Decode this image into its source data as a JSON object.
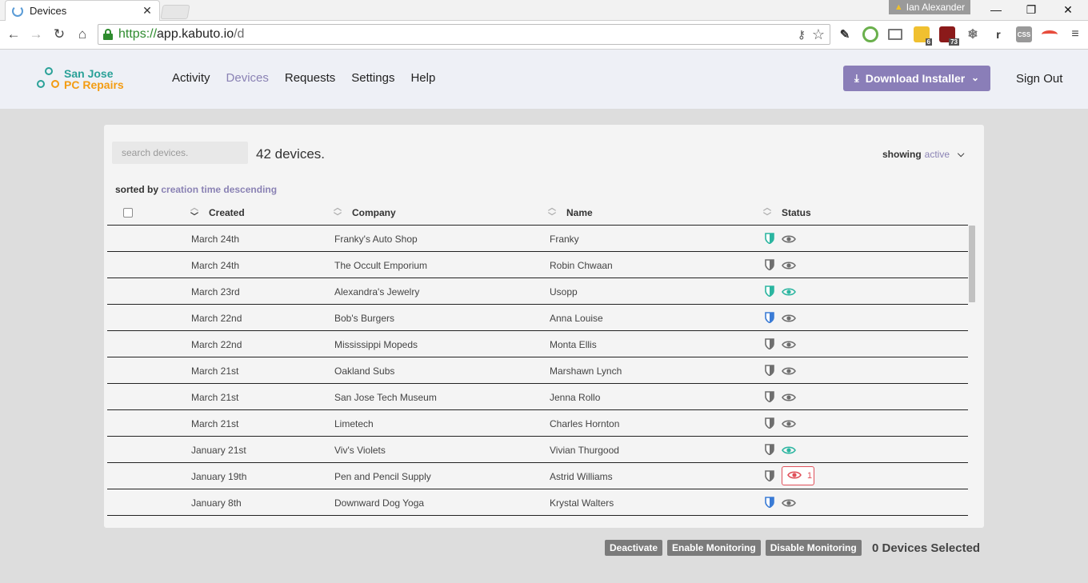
{
  "browser": {
    "tab_title": "Devices",
    "profile_name": "Ian Alexander",
    "url_proto": "https://",
    "url_host": "app.kabuto.io",
    "url_path": "/d",
    "ext_badges": [
      "6",
      "73"
    ]
  },
  "brand": {
    "line1": "San Jose",
    "line2": "PC Repairs"
  },
  "nav": {
    "items": [
      {
        "label": "Activity"
      },
      {
        "label": "Devices"
      },
      {
        "label": "Requests"
      },
      {
        "label": "Settings"
      },
      {
        "label": "Help"
      }
    ],
    "active": "Devices"
  },
  "header": {
    "download_label": "Download Installer",
    "signout_label": "Sign Out"
  },
  "toolbar": {
    "search_placeholder": "search devices.",
    "device_count": "42 devices.",
    "showing_label": "showing",
    "showing_value": "active",
    "sorted_label": "sorted by",
    "sorted_value": "creation time descending"
  },
  "table": {
    "columns": [
      "Created",
      "Company",
      "Name",
      "Status"
    ],
    "rows": [
      {
        "created": "March 24th",
        "company": "Franky's Auto Shop",
        "name": "Franky",
        "shield": "green",
        "eye": "gray"
      },
      {
        "created": "March 24th",
        "company": "The Occult Emporium",
        "name": "Robin Chwaan",
        "shield": "gray",
        "eye": "gray"
      },
      {
        "created": "March 23rd",
        "company": "Alexandra's Jewelry",
        "name": "Usopp",
        "shield": "green",
        "eye": "green"
      },
      {
        "created": "March 22nd",
        "company": "Bob's Burgers",
        "name": "Anna Louise",
        "shield": "blue",
        "eye": "gray"
      },
      {
        "created": "March 22nd",
        "company": "Mississippi Mopeds",
        "name": "Monta Ellis",
        "shield": "gray",
        "eye": "gray"
      },
      {
        "created": "March 21st",
        "company": "Oakland Subs",
        "name": "Marshawn Lynch",
        "shield": "gray",
        "eye": "gray"
      },
      {
        "created": "March 21st",
        "company": "San Jose Tech Museum",
        "name": "Jenna Rollo",
        "shield": "gray",
        "eye": "gray"
      },
      {
        "created": "March 21st",
        "company": "Limetech",
        "name": "Charles Hornton",
        "shield": "gray",
        "eye": "gray"
      },
      {
        "created": "January 21st",
        "company": "Viv's Violets",
        "name": "Vivian Thurgood",
        "shield": "gray",
        "eye": "green"
      },
      {
        "created": "January 19th",
        "company": "Pen and Pencil Supply",
        "name": "Astrid Williams",
        "shield": "gray",
        "eye": "alert",
        "alert_count": "1"
      },
      {
        "created": "January 8th",
        "company": "Downward Dog Yoga",
        "name": "Krystal Walters",
        "shield": "blue",
        "eye": "gray"
      }
    ]
  },
  "footer": {
    "deactivate_label": "Deactivate",
    "enable_label": "Enable Monitoring",
    "disable_label": "Disable Monitoring",
    "selected_text": "0 Devices Selected"
  },
  "colors": {
    "accent": "#8a7eb8",
    "shield_green": "#2bb5a0",
    "shield_blue": "#3a7bd5",
    "shield_gray": "#6e6e6e",
    "eye_gray": "#6e6e6e",
    "eye_green": "#2bb5a0",
    "alert_red": "#e0505a"
  }
}
